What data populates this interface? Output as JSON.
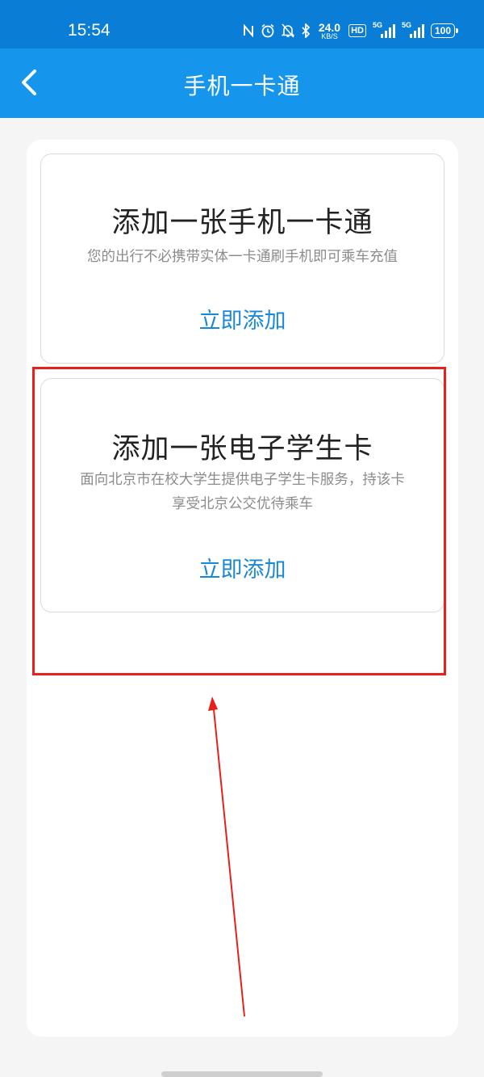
{
  "status_bar": {
    "time": "15:54",
    "net_speed_value": "24.0",
    "net_speed_unit": "KB/S",
    "hd_label": "HD",
    "signal_1_label": "5G",
    "signal_2_label": "5G",
    "battery": "100",
    "icons": [
      "nfc-icon",
      "alarm-icon",
      "mute-icon",
      "bluetooth-icon"
    ]
  },
  "header": {
    "title": "手机一卡通",
    "back_icon": "chevron-left-icon"
  },
  "cards": [
    {
      "title": "添加一张手机一卡通",
      "description": "您的出行不必携带实体一卡通刷手机即可乘车充值",
      "action_label": "立即添加"
    },
    {
      "title": "添加一张电子学生卡",
      "description_line1": "面向北京市在校大学生提供电子学生卡服务，持该卡",
      "description_line2": "享受北京公交优待乘车",
      "action_label": "立即添加"
    }
  ],
  "colors": {
    "status_bar": "#0a7ed6",
    "nav_bar": "#1596ec",
    "action_text": "#1a88d8",
    "highlight": "#e8201c",
    "background": "#f5f5f5"
  }
}
